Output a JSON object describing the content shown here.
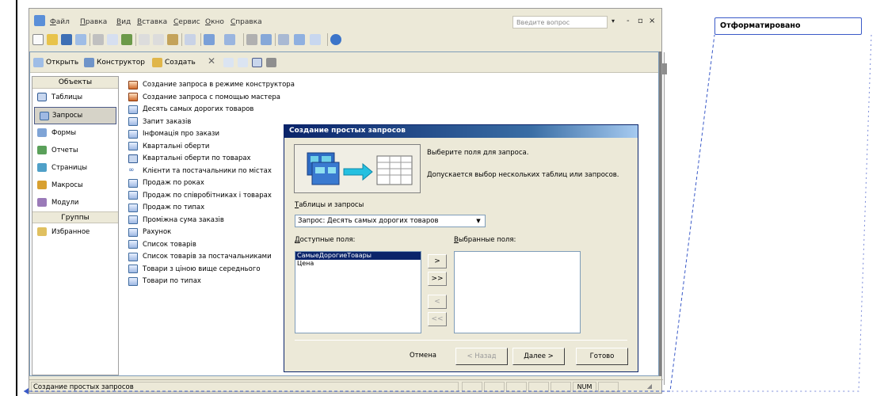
{
  "menu": [
    "Файл",
    "Правка",
    "Вид",
    "Вставка",
    "Сервис",
    "Окно",
    "Справка"
  ],
  "ask_placeholder": "Введите вопрос",
  "window_controls": [
    "-",
    "▫",
    "×"
  ],
  "db_toolbar": {
    "open": "Открыть",
    "design": "Конструктор",
    "create": "Создать"
  },
  "objects": {
    "header": "Объекты",
    "items": [
      "Таблицы",
      "Запросы",
      "Формы",
      "Отчеты",
      "Страницы",
      "Макросы",
      "Модули"
    ],
    "groups_header": "Группы",
    "groups": [
      "Избранное"
    ]
  },
  "queries": [
    "Создание запроса в режиме конструктора",
    "Создание запроса с помощью мастера",
    "Десять самых дорогих товаров",
    "Запит заказів",
    "Інфомація про закази",
    "Квартальні оберти",
    "Квартальні оберти по товарах",
    "Клієнти та постачальники по містах",
    "Продаж по роках",
    "Продаж по співробітниках і товарах",
    "Продаж по типах",
    "Проміжна сума заказів",
    "Рахунок",
    "Список товарів",
    "Список товарів за постачальниками",
    "Товари з ціною вище середнього",
    "Товари по типах"
  ],
  "dialog": {
    "title": "Создание простых запросов",
    "desc1": "Выберите поля для запроса.",
    "desc2": "Допускается выбор нескольких таблиц или запросов.",
    "tables_label": "Таблицы и запросы",
    "tables_value": "Запрос: Десять самых дорогих товаров",
    "available_label": "Доступные поля:",
    "selected_label": "Выбранные поля:",
    "available_fields": [
      "СамыеДорогиеТовары",
      "Цена"
    ],
    "move_buttons": [
      ">",
      ">>",
      "<",
      "<<"
    ],
    "buttons": {
      "cancel": "Отмена",
      "back": "< Назад",
      "next": "Далее >",
      "finish": "Готово"
    }
  },
  "status": {
    "text": "Создание простых запросов",
    "num": "NUM"
  },
  "comment": "Отформатировано"
}
